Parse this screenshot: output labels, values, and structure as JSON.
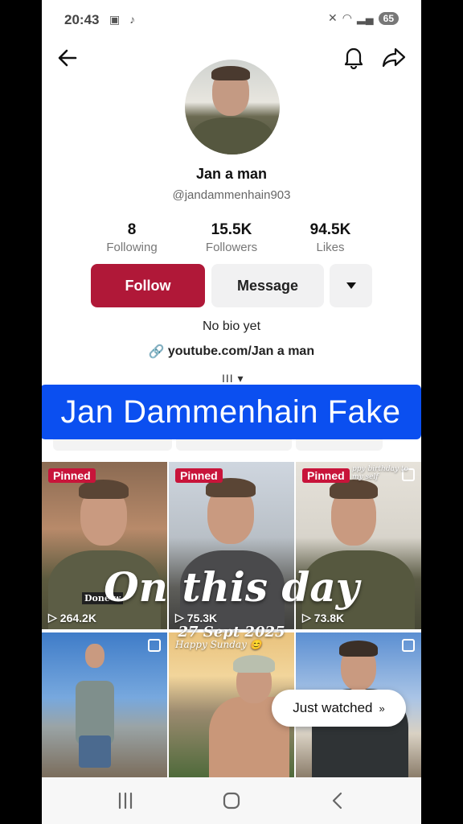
{
  "status_bar": {
    "time": "20:43",
    "battery": "65"
  },
  "profile": {
    "display_name": "Jan a man",
    "username": "@jandammenhain903",
    "stats": [
      {
        "value": "8",
        "label": "Following"
      },
      {
        "value": "15.5K",
        "label": "Followers"
      },
      {
        "value": "94.5K",
        "label": "Likes"
      }
    ],
    "follow_label": "Follow",
    "message_label": "Message",
    "bio": "No bio yet",
    "link": "youtube.com/Jan a man"
  },
  "overlay": {
    "banner": "Jan Dammenhain Fake",
    "on_this_day": "On this day",
    "date": "27 Sept 2025"
  },
  "videos": [
    {
      "pinned": "Pinned",
      "views": "264.2K",
      "caption": "Done w"
    },
    {
      "pinned": "Pinned",
      "views": "75.3K",
      "caption": ""
    },
    {
      "pinned": "Pinned",
      "views": "73.8K",
      "caption": "ppy birthday to my self"
    },
    {
      "pinned": "",
      "views": "",
      "caption": ""
    },
    {
      "pinned": "",
      "views": "",
      "caption": "Happy Sunday 😊"
    },
    {
      "pinned": "",
      "views": "",
      "caption": ""
    }
  ],
  "just_watched": "Just watched",
  "colors": {
    "follow": "#b01838",
    "banner": "#0b4ff0",
    "pinned": "#c8143a"
  }
}
